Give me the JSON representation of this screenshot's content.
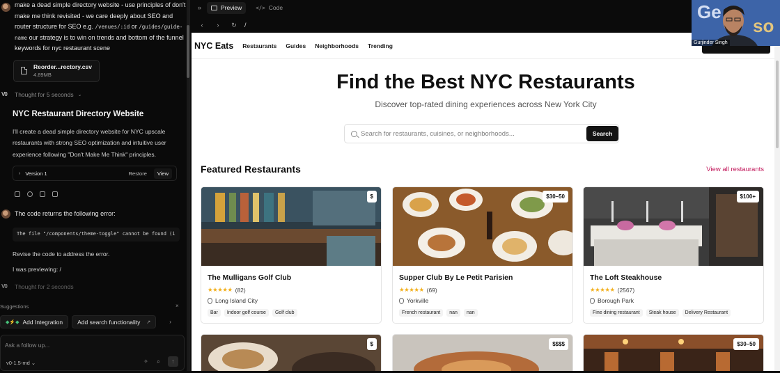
{
  "chat": {
    "user_message_1": {
      "before_code1": "make a dead simple directory website - use principles of don't make me think revisited - we care deeply about SEO and router structure for SEO e.g. ",
      "code1": "/venues/:id",
      "between": " or ",
      "code2": "/guides/guide-name",
      "after": " our strategy is to win on trends and bottom of the funnel keywords for nyc restaurant scene"
    },
    "attachment": {
      "name": "Reorder...rectory.csv",
      "size": "4.89MB"
    },
    "thought_1": "Thought for 5 seconds",
    "response_title": "NYC Restaurant Directory Website",
    "response_body": "I'll create a dead simple directory website for NYC upscale restaurants with strong SEO optimization and intuitive user experience following \"Don't Make Me Think\" principles.",
    "version": {
      "label": "Version 1",
      "restore": "Restore",
      "view": "View"
    },
    "user_message_2": "The code returns the following error:",
    "error_code": "The file \"/components/theme-toggle\" cannot be found (i",
    "revise_line": "Revise the code to address the error.",
    "previewing_line": "I was previewing: /",
    "thought_2": "Thought for 2 seconds",
    "suggestions_label": "Suggestions",
    "suggestions": [
      {
        "label": "Add Integration"
      },
      {
        "label": "Add search functionality"
      }
    ],
    "composer_placeholder": "Ask a follow up...",
    "model": "v0-1.5-md"
  },
  "toolbar": {
    "preview_tab": "Preview",
    "code_tab": "Code",
    "address": "/"
  },
  "site": {
    "brand": "NYC Eats",
    "nav": [
      "Restaurants",
      "Guides",
      "Neighborhoods",
      "Trending"
    ],
    "hero_title": "Find the Best NYC Restaurants",
    "hero_subtitle": "Discover top-rated dining experiences across New York City",
    "search_placeholder": "Search for restaurants, cuisines, or neighborhoods...",
    "search_button": "Search",
    "section_title": "Featured Restaurants",
    "view_all": "View all restaurants",
    "cards": [
      {
        "name": "The Mulligans Golf Club",
        "price": "$",
        "rating_count": "(82)",
        "location": "Long Island City",
        "tags": [
          "Bar",
          "Indoor golf course",
          "Golf club"
        ]
      },
      {
        "name": "Supper Club By Le Petit Parisien",
        "price": "$30–50",
        "rating_count": "(69)",
        "location": "Yorkville",
        "tags": [
          "French restaurant",
          "nan",
          "nan"
        ]
      },
      {
        "name": "The Loft Steakhouse",
        "price": "$100+",
        "rating_count": "(2567)",
        "location": "Borough Park",
        "tags": [
          "Fine dining restaurant",
          "Steak house",
          "Delivery Restaurant"
        ]
      }
    ],
    "second_row_prices": [
      "$",
      "$$$$",
      "$30–50"
    ],
    "stars": "★★★★★"
  },
  "webcam": {
    "name": "Gurjinder Singh"
  },
  "colors": {
    "accent_link": "#c2185b",
    "star": "#f2b01e",
    "dark_button": "#131313"
  }
}
